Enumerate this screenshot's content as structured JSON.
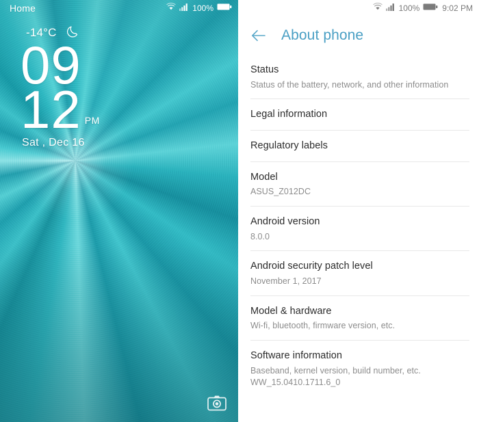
{
  "left_screen": {
    "status_bar": {
      "home_label": "Home",
      "wifi_icon": "wifi-icon",
      "signal_icon": "signal-bars-icon",
      "battery_percent": "100%",
      "battery_icon": "battery-full-icon"
    },
    "clock_widget": {
      "temperature": "-14°C",
      "weather_icon": "moon-icon",
      "hour": "09",
      "minute": "12",
      "ampm": "PM",
      "date": "Sat , Dec 16"
    },
    "camera_shortcut": {
      "icon": "camera-icon"
    },
    "colors": {
      "wallpaper_base": "#2fb8c2",
      "text": "#ffffff"
    }
  },
  "right_screen": {
    "status_bar": {
      "wifi_icon": "wifi-icon",
      "signal_icon": "signal-bars-icon",
      "battery_percent": "100%",
      "battery_icon": "battery-full-icon",
      "time": "9:02 PM"
    },
    "header": {
      "back_icon": "arrow-left-icon",
      "title": "About phone",
      "accent_color": "#4a9fc4"
    },
    "items": [
      {
        "title": "Status",
        "sub": "Status of the battery, network, and other information",
        "sub2": ""
      },
      {
        "title": "Legal information",
        "sub": "",
        "sub2": ""
      },
      {
        "title": "Regulatory labels",
        "sub": "",
        "sub2": ""
      },
      {
        "title": "Model",
        "sub": "ASUS_Z012DC",
        "sub2": ""
      },
      {
        "title": "Android version",
        "sub": "8.0.0",
        "sub2": ""
      },
      {
        "title": "Android security patch level",
        "sub": "November 1, 2017",
        "sub2": ""
      },
      {
        "title": "Model & hardware",
        "sub": "Wi-fi, bluetooth, firmware version, etc.",
        "sub2": ""
      },
      {
        "title": "Software information",
        "sub": "Baseband, kernel version, build number, etc.",
        "sub2": "WW_15.0410.1711.6_0"
      }
    ]
  }
}
